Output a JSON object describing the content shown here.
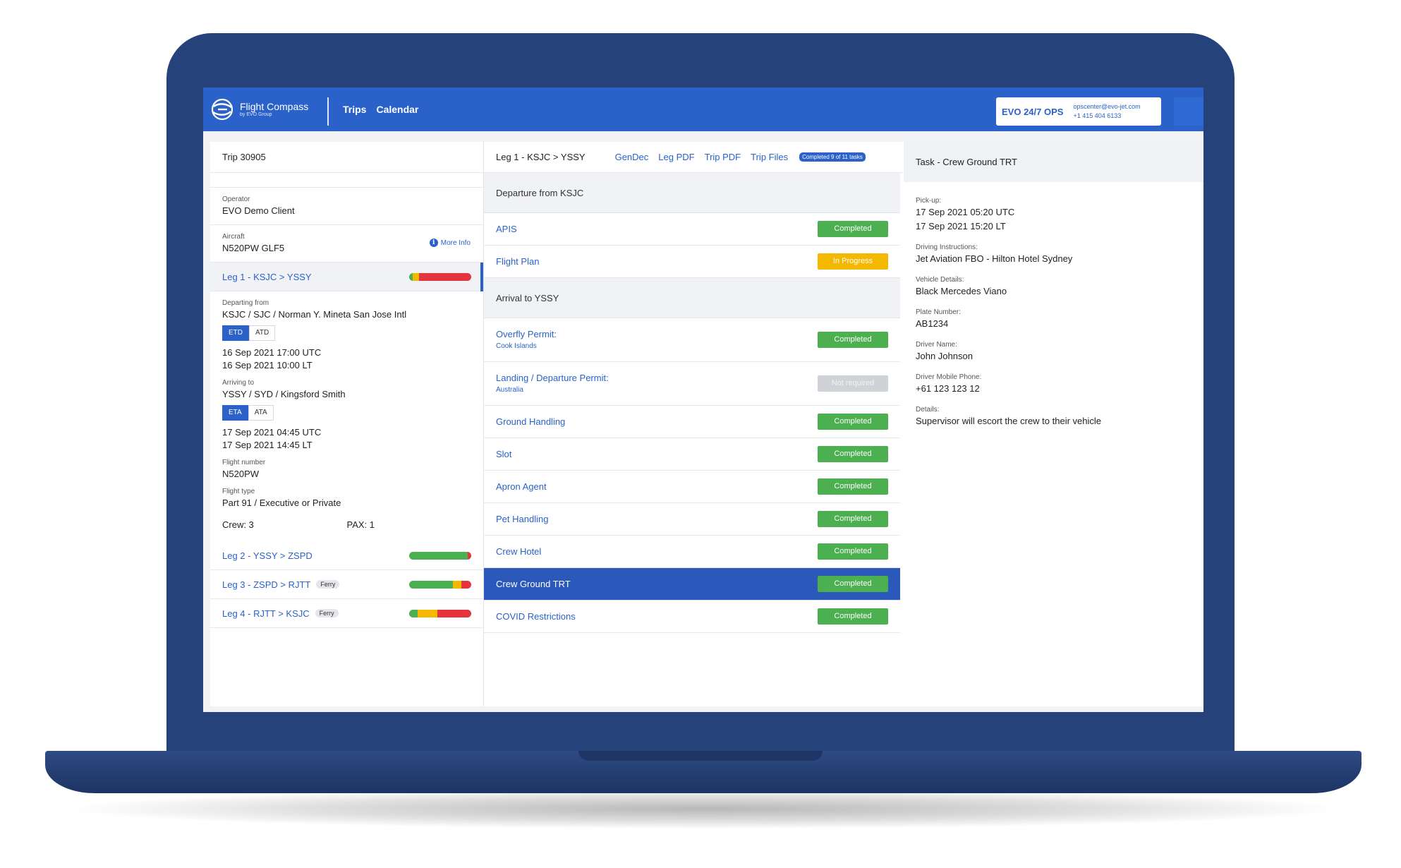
{
  "brand": {
    "name": "Flight Compass",
    "sub": "by EVO Group"
  },
  "nav": {
    "trips": "Trips",
    "calendar": "Calendar"
  },
  "ops": {
    "label": "EVO 24/7 OPS",
    "email": "opscenter@evo-jet.com",
    "phone": "+1 415 404 6133"
  },
  "trip": {
    "title": "Trip 30905",
    "operator_label": "Operator",
    "operator": "EVO Demo Client",
    "aircraft_label": "Aircraft",
    "aircraft": "N520PW GLF5",
    "more_info": "More Info"
  },
  "legs": [
    {
      "label": "Leg 1 - KSJC > YSSY",
      "ferry": "",
      "bar": {
        "green": 0.06,
        "yellow": 0.1,
        "red": 0.84
      }
    },
    {
      "label": "Leg 2 - YSSY > ZSPD",
      "ferry": "",
      "bar": {
        "green": 0.94,
        "yellow": 0.0,
        "red": 0.06
      }
    },
    {
      "label": "Leg 3 - ZSPD > RJTT",
      "ferry": "Ferry",
      "bar": {
        "green": 0.7,
        "yellow": 0.14,
        "red": 0.16
      }
    },
    {
      "label": "Leg 4 - RJTT > KSJC",
      "ferry": "Ferry",
      "bar": {
        "green": 0.14,
        "yellow": 0.32,
        "red": 0.54
      }
    }
  ],
  "leg_detail": {
    "departing_label": "Departing from",
    "departing": "KSJC / SJC / Norman Y. Mineta San Jose Intl",
    "etd": "ETD",
    "atd": "ATD",
    "dep_utc": "16 Sep 2021 17:00 UTC",
    "dep_lt": "16 Sep 2021 10:00 LT",
    "arriving_label": "Arriving to",
    "arriving": "YSSY / SYD / Kingsford Smith",
    "eta": "ETA",
    "ata": "ATA",
    "arr_utc": "17 Sep 2021 04:45 UTC",
    "arr_lt": "17 Sep 2021 14:45 LT",
    "flight_number_label": "Flight number",
    "flight_number": "N520PW",
    "flight_type_label": "Flight type",
    "flight_type": "Part 91 / Executive or Private",
    "crew": "Crew: 3",
    "pax": "PAX: 1"
  },
  "mid": {
    "title": "Leg 1 - KSJC > YSSY",
    "links": [
      "GenDec",
      "Leg PDF",
      "Trip PDF",
      "Trip Files"
    ],
    "progress": "Completed 9 of 11 tasks",
    "departure_section": "Departure from KSJC",
    "arrival_section": "Arrival to YSSY",
    "departure_tasks": [
      {
        "name": "APIS",
        "status": "Completed"
      },
      {
        "name": "Flight Plan",
        "status": "In Progress"
      }
    ],
    "arrival_tasks": [
      {
        "name": "Overfly Permit:",
        "sub": "Cook Islands",
        "status": "Completed"
      },
      {
        "name": "Landing / Departure Permit:",
        "sub": "Australia",
        "status": "Not required"
      },
      {
        "name": "Ground Handling",
        "status": "Completed"
      },
      {
        "name": "Slot",
        "status": "Completed"
      },
      {
        "name": "Apron Agent",
        "status": "Completed"
      },
      {
        "name": "Pet Handling",
        "status": "Completed"
      },
      {
        "name": "Crew Hotel",
        "status": "Completed"
      },
      {
        "name": "Crew Ground TRT",
        "status": "Completed"
      },
      {
        "name": "COVID Restrictions",
        "status": "Completed"
      }
    ]
  },
  "task": {
    "title": "Task - Crew Ground TRT",
    "pickup_label": "Pick-up:",
    "pickup_utc": "17 Sep 2021 05:20 UTC",
    "pickup_lt": "17 Sep 2021 15:20 LT",
    "driving_label": "Driving Instructions:",
    "driving": "Jet Aviation FBO - Hilton Hotel Sydney",
    "vehicle_label": "Vehicle Details:",
    "vehicle": "Black Mercedes Viano",
    "plate_label": "Plate Number:",
    "plate": "AB1234",
    "driver_label": "Driver Name:",
    "driver": "John Johnson",
    "phone_label": "Driver Mobile Phone:",
    "phone": "+61 123 123 12",
    "details_label": "Details:",
    "details": "Supervisor will escort the crew to their vehicle"
  },
  "colors": {
    "primary": "#2a62c9",
    "laptop": "#26427a",
    "green": "#4caf50",
    "yellow": "#f5b800",
    "red": "#e5343d",
    "grey": "#cfd2d6"
  }
}
